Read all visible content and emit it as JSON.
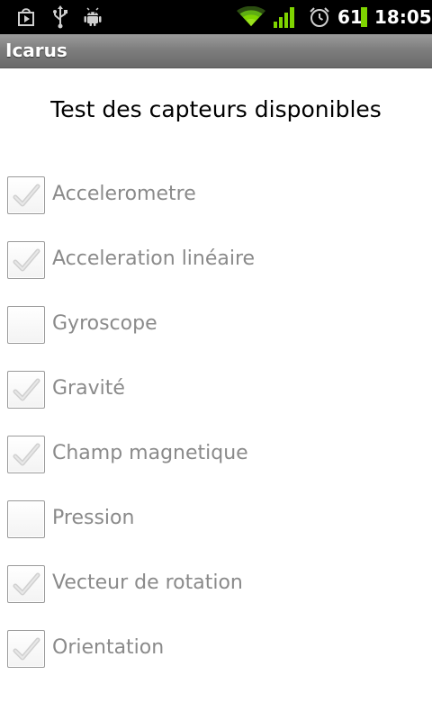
{
  "status_bar": {
    "icons": [
      "play-store-notification-icon",
      "usb-icon",
      "android-debug-icon",
      "wifi-icon",
      "signal-icon",
      "alarm-icon"
    ],
    "battery_level": "61",
    "battery_color": "#7fd400",
    "time": "18:05"
  },
  "app": {
    "title": "Icarus"
  },
  "main": {
    "heading": "Test des capteurs disponibles",
    "sensors": [
      {
        "label": "Accelerometre",
        "checked": true
      },
      {
        "label": "Acceleration linéaire",
        "checked": true
      },
      {
        "label": "Gyroscope",
        "checked": false
      },
      {
        "label": "Gravité",
        "checked": true
      },
      {
        "label": "Champ magnetique",
        "checked": true
      },
      {
        "label": "Pression",
        "checked": false
      },
      {
        "label": "Vecteur de rotation",
        "checked": true
      },
      {
        "label": "Orientation",
        "checked": true
      }
    ]
  },
  "colors": {
    "status_bar_bg": "#000000",
    "title_bar_bg": "#7e7e7e",
    "label_text": "#8a8a8a",
    "heading_text": "#000000"
  }
}
